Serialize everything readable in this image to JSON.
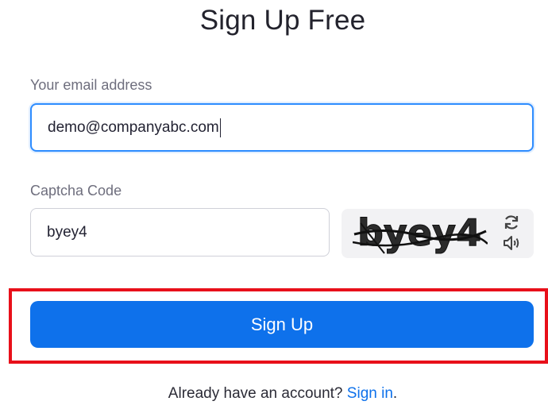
{
  "page": {
    "title": "Sign Up Free"
  },
  "email": {
    "label": "Your email address",
    "value": "demo@companyabc.com"
  },
  "captcha": {
    "label": "Captcha Code",
    "value": "byey4",
    "image_text": "byey4"
  },
  "signup_button": {
    "label": "Sign Up"
  },
  "footer": {
    "prompt": "Already have an account? ",
    "link": "Sign in",
    "suffix": "."
  },
  "colors": {
    "primary": "#0e71eb",
    "focus_border": "#2d8cff",
    "highlight": "#e8101a"
  },
  "icons": {
    "refresh": "refresh-icon",
    "audio": "speaker-icon"
  }
}
